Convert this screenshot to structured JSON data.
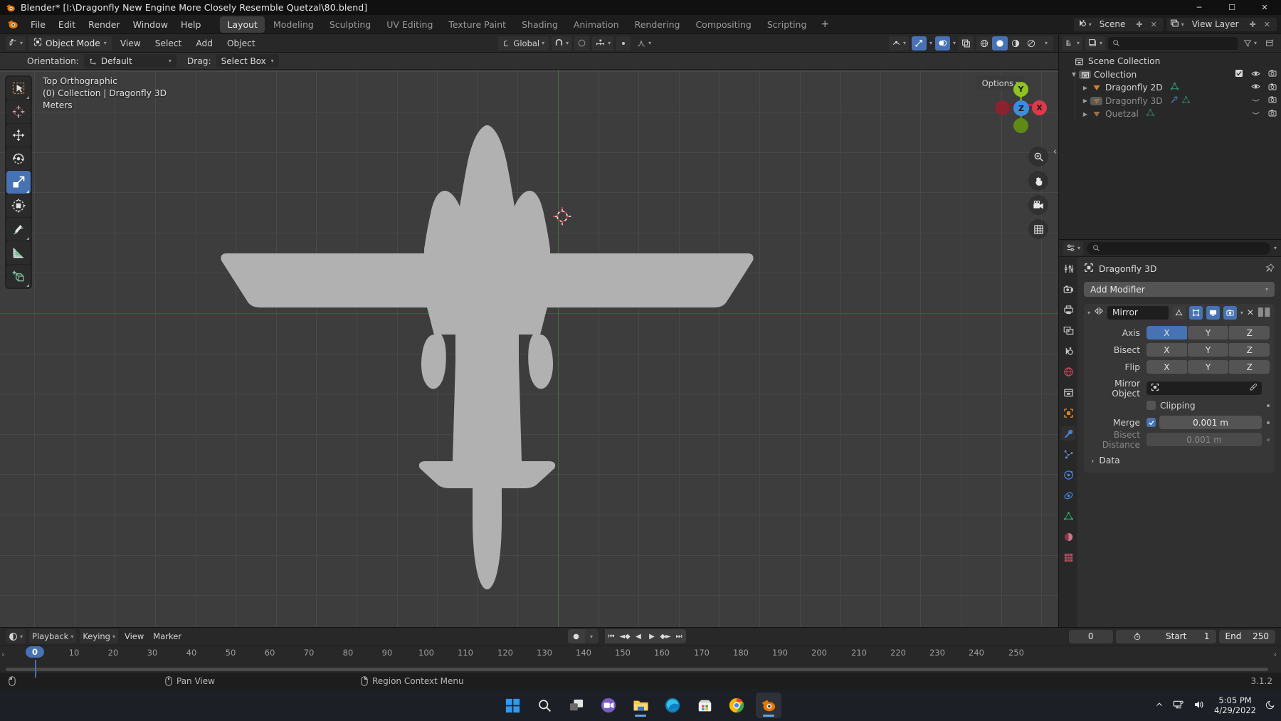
{
  "titlebar": {
    "title": "Blender* [I:\\Dragonfly New Engine More Closely Resemble Quetzal\\80.blend]",
    "minimize": "─",
    "maximize": "☐",
    "close": "✕"
  },
  "topbar": {
    "menus": [
      "File",
      "Edit",
      "Render",
      "Window",
      "Help"
    ],
    "workspace_tabs": [
      "Layout",
      "Modeling",
      "Sculpting",
      "UV Editing",
      "Texture Paint",
      "Shading",
      "Animation",
      "Rendering",
      "Compositing",
      "Scripting"
    ],
    "active_tab": "Layout",
    "add_tab": "+",
    "scene_name": "Scene",
    "view_layer_name": "View Layer",
    "scene_icon": "scene-icon",
    "viewlayer_icon": "view-layer-icon",
    "close_x": "✕"
  },
  "viewport_header": {
    "editor_type_icon": "editor-type-3dview-icon",
    "mode": "Object Mode",
    "mode_icon": "object-mode-icon",
    "menus": [
      "View",
      "Select",
      "Add",
      "Object"
    ],
    "transform_orientation": "Global",
    "snap_icon": "magnet-icon",
    "proportional_icon": "proportional-edit-icon",
    "falloff_icon": "falloff-curve-icon",
    "visibility_icon": "show-hide-icon",
    "gizmo_icon": "gizmo-icon",
    "overlays_icon": "overlays-icon",
    "xray_icon": "xray-icon",
    "shading_modes": [
      "wireframe",
      "solid",
      "material-preview",
      "rendered"
    ],
    "active_shading": "solid"
  },
  "tool_settings": {
    "orientation_label": "Orientation:",
    "orientation_value": "Default",
    "drag_label": "Drag:",
    "drag_value": "Select Box"
  },
  "viewport": {
    "view_name": "Top Orthographic",
    "collection_line": "(0) Collection | Dragonfly 3D",
    "units": "Meters",
    "options_label": "Options",
    "tools": [
      "tweak-select-box-tool",
      "cursor-tool",
      "move-tool",
      "rotate-tool",
      "scale-tool",
      "transform-tool",
      "annotate-tool",
      "measure-tool",
      "add-cube-tool"
    ],
    "active_tool": "scale-tool",
    "gizmo_axes": [
      "X",
      "Y",
      "Z"
    ],
    "nav_buttons": [
      "zoom-icon",
      "pan-hand-icon",
      "camera-icon",
      "grid-ortho-icon"
    ],
    "colors": {
      "axis_x": "#e0384a",
      "axis_y": "#8fc31f",
      "axis_z": "#3b8ede",
      "background": "#3d3d3d",
      "mesh_fill": "#b0b0b0"
    }
  },
  "outliner": {
    "display_mode_icon": "outliner-display-mode-icon",
    "filter_icon": "filter-icon",
    "new_collection_icon": "new-collection-icon",
    "search_placeholder": "",
    "search_icon": "search-icon",
    "rows": [
      {
        "label": "Scene Collection",
        "icon": "scene-collection-icon",
        "depth": 0,
        "expander": "",
        "dim": false,
        "eye": false,
        "camera": false,
        "check": false
      },
      {
        "label": "Collection",
        "icon": "collection-icon",
        "depth": 1,
        "expander": "▼",
        "dim": false,
        "eye": true,
        "camera": true,
        "check": true
      },
      {
        "label": "Dragonfly 2D",
        "icon": "object-mesh-icon",
        "depth": 2,
        "expander": "▶",
        "dim": false,
        "eye": true,
        "camera": true,
        "check": false,
        "data_icons": [
          "mesh-data-icon"
        ]
      },
      {
        "label": "Dragonfly 3D",
        "icon": "object-mesh-icon",
        "depth": 2,
        "expander": "▶",
        "dim": true,
        "eye": false,
        "camera": true,
        "check": false,
        "data_icons": [
          "modifier-wrench-icon",
          "mesh-data-icon"
        ]
      },
      {
        "label": "Quetzal",
        "icon": "object-mesh-icon",
        "depth": 2,
        "expander": "▶",
        "dim": true,
        "eye": false,
        "camera": true,
        "check": false,
        "data_icons": [
          "mesh-data-icon"
        ]
      }
    ]
  },
  "properties": {
    "editor_icon": "properties-editor-icon",
    "search_placeholder": "",
    "object_name": "Dragonfly 3D",
    "object_icon": "object-icon",
    "pin_icon": "pin-icon",
    "add_modifier_label": "Add Modifier",
    "tabs": [
      "tool-tab",
      "render-tab",
      "output-tab",
      "view-layer-tab",
      "scene-tab",
      "world-tab",
      "collection-tab",
      "object-tab",
      "modifier-tab",
      "particles-tab",
      "physics-tab",
      "constraints-tab",
      "data-tab",
      "material-tab",
      "texture-tab"
    ],
    "active_tab": "modifier-tab",
    "modifier": {
      "name": "Mirror",
      "icon": "mirror-modifier-icon",
      "toggles": [
        {
          "name": "on-cage",
          "on": false
        },
        {
          "name": "edit-mode",
          "on": true
        },
        {
          "name": "realtime-display",
          "on": true
        },
        {
          "name": "render-display",
          "on": true
        }
      ],
      "dropdown": "⌄",
      "delete": "✕",
      "rows": [
        {
          "label": "Axis",
          "type": "segments",
          "options": [
            "X",
            "Y",
            "Z"
          ],
          "selected": [
            "X"
          ]
        },
        {
          "label": "Bisect",
          "type": "segments",
          "options": [
            "X",
            "Y",
            "Z"
          ],
          "selected": []
        },
        {
          "label": "Flip",
          "type": "segments",
          "options": [
            "X",
            "Y",
            "Z"
          ],
          "selected": []
        }
      ],
      "mirror_object_label": "Mirror Object",
      "mirror_object_value": "",
      "mirror_object_icon": "object-icon",
      "eyedropper_icon": "eyedropper-icon",
      "clipping_label": "Clipping",
      "clipping_checked": false,
      "merge_label": "Merge",
      "merge_checked": true,
      "merge_value": "0.001 m",
      "bisect_distance_label": "Bisect Distance",
      "bisect_distance_value": "0.001 m",
      "data_label": "Data",
      "data_expander": "›"
    }
  },
  "timeline": {
    "editor_icon": "timeline-editor-icon",
    "menus": [
      "Playback",
      "Keying",
      "View",
      "Marker"
    ],
    "record_icon": "auto-keying-record-icon",
    "playback_buttons": [
      "jump-to-start",
      "jump-prev-keyframe",
      "play-reverse",
      "play",
      "jump-next-keyframe",
      "jump-to-end"
    ],
    "current_frame": "0",
    "timer_icon": "timer-icon",
    "start_label": "Start",
    "start_value": "1",
    "end_label": "End",
    "end_value": "250",
    "playhead_frame": "0",
    "ticks": [
      "0",
      "10",
      "20",
      "30",
      "40",
      "50",
      "60",
      "70",
      "80",
      "90",
      "100",
      "110",
      "120",
      "130",
      "140",
      "150",
      "160",
      "170",
      "180",
      "190",
      "200",
      "210",
      "220",
      "230",
      "240",
      "250"
    ]
  },
  "statusbar": {
    "mouse_left_icon": "mouse-left-icon",
    "mouse_middle_icon": "mouse-middle-icon",
    "mouse_middle_label": "Pan View",
    "mouse_right_icon": "mouse-right-icon",
    "mouse_right_label": "Region Context Menu",
    "version": "3.1.2"
  },
  "taskbar": {
    "icons": [
      "windows-start-icon",
      "search-icon",
      "task-view-icon",
      "teams-icon",
      "file-explorer-icon",
      "edge-icon",
      "microsoft-store-icon",
      "chrome-icon",
      "blender-icon"
    ],
    "active_icon": "blender-icon",
    "tray": [
      "show-hidden-icons-chevron",
      "network-icon",
      "volume-icon"
    ],
    "time": "5:05 PM",
    "date": "4/29/2022",
    "notification_icon": "moon-do-not-disturb-icon"
  }
}
